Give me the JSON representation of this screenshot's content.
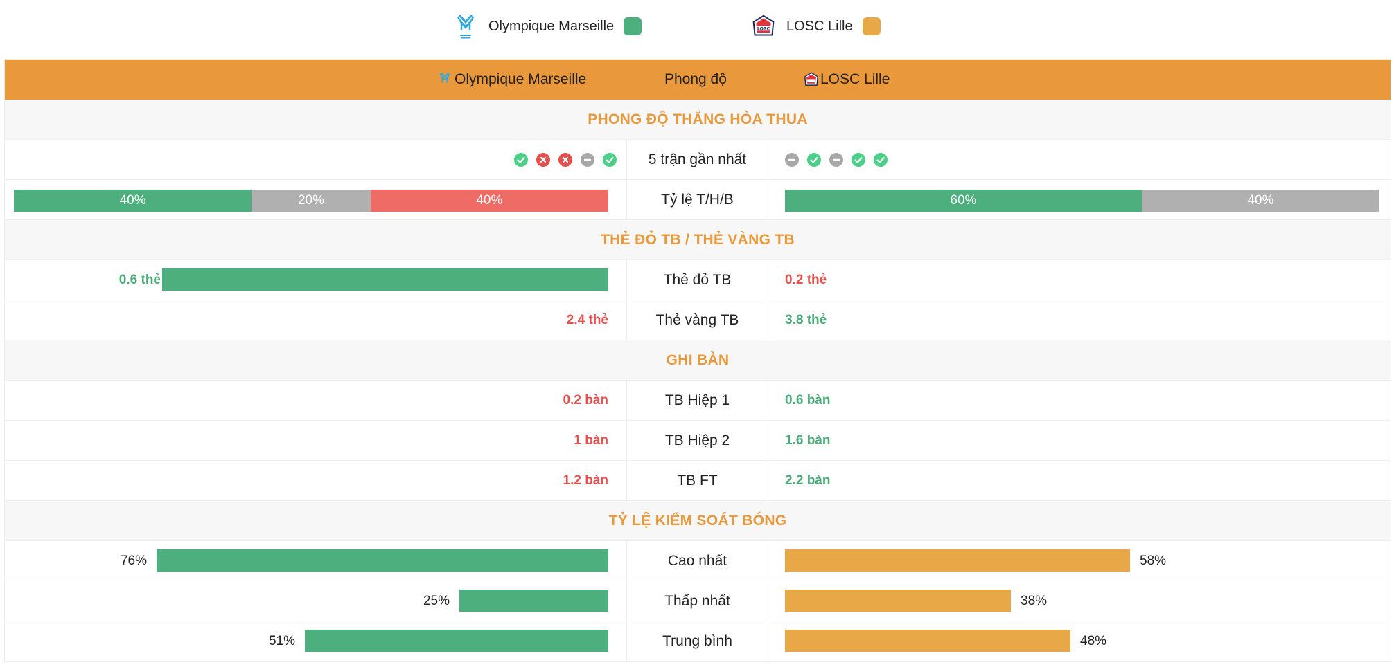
{
  "colors": {
    "home": "#4caf7d",
    "away": "#e9a848",
    "accent": "#e9993b",
    "win": "#4bd08a",
    "draw": "#a8a8a8",
    "loss": "#e4514f"
  },
  "legend": {
    "home": {
      "name": "Olympique Marseille",
      "icon": "marseille-crest-icon"
    },
    "away": {
      "name": "LOSC Lille",
      "icon": "lille-crest-icon"
    }
  },
  "header": {
    "home": "Olympique Marseille",
    "mid": "Phong độ",
    "away": "LOSC Lille"
  },
  "sections": {
    "form": "PHONG ĐỘ THẮNG HÒA THUA",
    "cards": "THẺ ĐỎ TB / THẺ VÀNG TB",
    "goals": "GHI BÀN",
    "possession": "TỶ LỆ KIỂM SOÁT BÓNG"
  },
  "form": {
    "label": "5 trận gần nhất",
    "home": [
      "W",
      "L",
      "L",
      "D",
      "W"
    ],
    "away": [
      "D",
      "W",
      "D",
      "W",
      "W"
    ]
  },
  "ratio": {
    "label": "Tỷ lệ T/H/B",
    "home": [
      {
        "type": "win",
        "pct": 40,
        "text": "40%"
      },
      {
        "type": "draw",
        "pct": 20,
        "text": "20%"
      },
      {
        "type": "loss",
        "pct": 40,
        "text": "40%"
      }
    ],
    "away": [
      {
        "type": "win",
        "pct": 60,
        "text": "60%"
      },
      {
        "type": "draw",
        "pct": 40,
        "text": "40%"
      }
    ]
  },
  "cards": {
    "red": {
      "label": "Thẻ đỏ TB",
      "home": "0.6 thẻ",
      "away": "0.2 thẻ",
      "home_fill": 0.75
    },
    "yellow": {
      "label": "Thẻ vàng TB",
      "home": "2.4 thẻ",
      "away": "3.8 thẻ"
    }
  },
  "goals": {
    "h1": {
      "label": "TB Hiệp 1",
      "home": "0.2 bàn",
      "away": "0.6 bàn"
    },
    "h2": {
      "label": "TB Hiệp 2",
      "home": "1 bàn",
      "away": "1.6 bàn"
    },
    "ft": {
      "label": "TB FT",
      "home": "1.2 bàn",
      "away": "2.2 bàn"
    }
  },
  "possession": {
    "max": {
      "label": "Cao nhất",
      "home": "76%",
      "away": "58%",
      "home_pct": 76,
      "away_pct": 58
    },
    "min": {
      "label": "Thấp nhất",
      "home": "25%",
      "away": "38%",
      "home_pct": 25,
      "away_pct": 38
    },
    "avg": {
      "label": "Trung bình",
      "home": "51%",
      "away": "48%",
      "home_pct": 51,
      "away_pct": 48
    }
  }
}
